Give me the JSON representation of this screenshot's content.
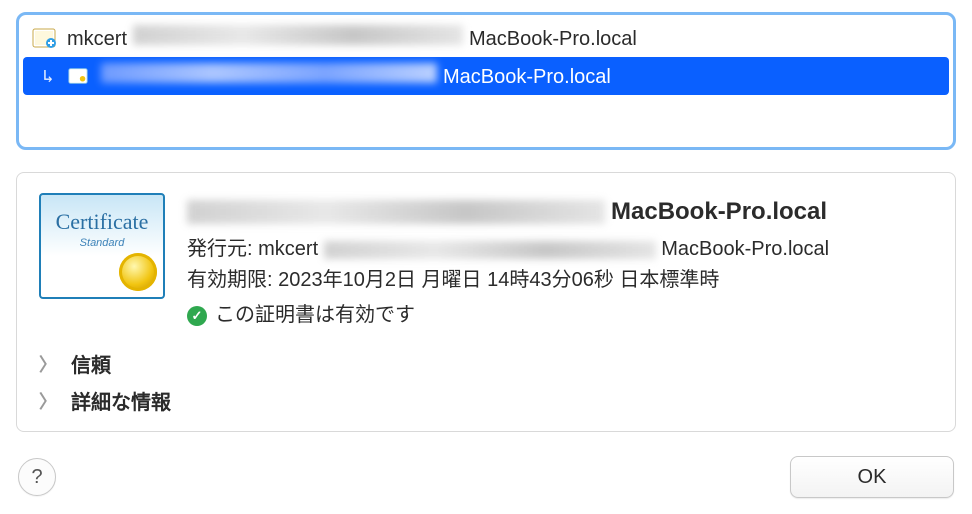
{
  "list": {
    "root": {
      "prefix": "mkcert",
      "suffix": "MacBook-Pro.local"
    },
    "child": {
      "suffix": "MacBook-Pro.local"
    }
  },
  "detail": {
    "title_suffix": "MacBook-Pro.local",
    "issuer_label": "発行元:",
    "issuer_prefix": "mkcert",
    "issuer_suffix": "MacBook-Pro.local",
    "expiry_label": "有効期限:",
    "expiry_value": "2023年10月2日 月曜日 14時43分06秒 日本標準時",
    "status_text": "この証明書は有効です",
    "badge_title": "Certificate",
    "badge_sub": "Standard"
  },
  "sections": {
    "trust": "信頼",
    "details": "詳細な情報"
  },
  "footer": {
    "help": "?",
    "ok": "OK"
  },
  "colors": {
    "selection": "#0a60ff",
    "focus_ring": "#7ab8f5",
    "status_ok": "#2fa84f"
  }
}
